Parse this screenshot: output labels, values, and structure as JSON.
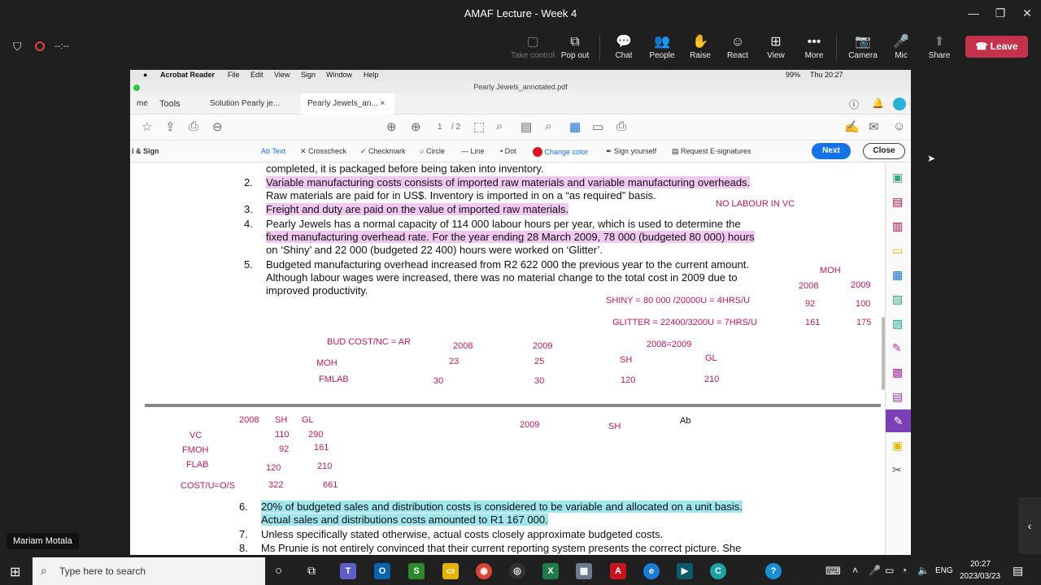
{
  "window": {
    "title": "AMAF Lecture - Week 4",
    "minimize": "—",
    "maximize": "❐",
    "close": "✕"
  },
  "meeting": {
    "timer": "--:--",
    "toolbar": [
      {
        "label": "Take control",
        "icon": "take-control-icon",
        "glyph": "▢"
      },
      {
        "label": "Pop out",
        "icon": "pop-out-icon",
        "glyph": "⧉"
      },
      {
        "label": "Chat",
        "icon": "chat-icon",
        "glyph": "💬"
      },
      {
        "label": "People",
        "icon": "people-icon",
        "glyph": "👥"
      },
      {
        "label": "Raise",
        "icon": "raise-hand-icon",
        "glyph": "✋"
      },
      {
        "label": "React",
        "icon": "react-icon",
        "glyph": "☺"
      },
      {
        "label": "View",
        "icon": "view-icon",
        "glyph": "⊞"
      },
      {
        "label": "More",
        "icon": "more-icon",
        "glyph": "•••"
      },
      {
        "label": "Camera",
        "icon": "camera-icon",
        "glyph": "📷"
      },
      {
        "label": "Mic",
        "icon": "mic-icon",
        "glyph": "🎤"
      },
      {
        "label": "Share",
        "icon": "share-icon",
        "glyph": "⬆"
      }
    ],
    "leave_label": "Leave",
    "presenter_name": "Mariam Motala"
  },
  "acrobat": {
    "mac_menu": [
      "Acrobat Reader",
      "File",
      "Edit",
      "View",
      "Sign",
      "Window",
      "Help"
    ],
    "battery": "99%",
    "clock": "Thu 20:27",
    "doc_title": "Pearly Jewels_annotated.pdf",
    "tabs": [
      "me",
      "Tools",
      "Solution Pearly je...",
      "Pearly Jewels_an..."
    ],
    "page_current": "1",
    "page_total": "/ 2",
    "tool_label": "l & Sign",
    "anno_tools": [
      "Ab Text",
      "Crosscheck",
      "Checkmark",
      "Circle",
      "Line",
      "Dot",
      "Change color",
      "Sign yourself",
      "Request E-signatures"
    ],
    "next_label": "Next",
    "close_label": "Close"
  },
  "document": {
    "lines": [
      {
        "n": "",
        "text": "completed, it is packaged before being taken into inventory."
      },
      {
        "n": "2.",
        "text": "Variable manufacturing costs consists of imported raw materials and variable manufacturing overheads."
      },
      {
        "n": "",
        "text": "Raw materials are paid for in US$.  Inventory is imported in on a “as required” basis."
      },
      {
        "n": "3.",
        "text": "Freight and duty are paid on the value of imported raw materials."
      },
      {
        "n": "4.",
        "text": "Pearly Jewels has a normal capacity of 114 000 labour hours per year, which is used to determine the"
      },
      {
        "n": "",
        "text": "fixed manufacturing overhead rate.  For the year ending 28 March 2009, 78 000 (budgeted 80 000) hours"
      },
      {
        "n": "",
        "text": "on ‘Shiny’ and 22 000 (budgeted 22 400) hours were worked on ‘Glitter’."
      },
      {
        "n": "5.",
        "text": "Budgeted manufacturing overhead increased from R2 622 000 the previous year to the current amount."
      },
      {
        "n": "",
        "text": "Although labour wages were increased, there was no material change to the total cost in 2009 due to"
      },
      {
        "n": "",
        "text": "improved productivity."
      },
      {
        "n": "6.",
        "text": "20% of budgeted sales and distribution costs is considered to be variable and allocated on a unit basis."
      },
      {
        "n": "",
        "text": "Actual sales and distributions costs amounted to R1 167 000."
      },
      {
        "n": "7.",
        "text": "Unless specifically stated otherwise, actual costs closely approximate budgeted costs."
      },
      {
        "n": "8.",
        "text": "Ms Prunie is not entirely convinced that their current reporting system presents the correct picture.  She"
      }
    ],
    "annotations": [
      "NO LABOUR IN VC",
      "MOH",
      "2008",
      "2009",
      "SHINY = 80 000 /20000U = 4HRS/U",
      "92",
      "100",
      "GLITTER = 22400/3200U = 7HRS/U",
      "161",
      "175",
      "BUD COST/NC = AR",
      "2008",
      "2009",
      "2008=2009",
      "MOH",
      "23",
      "25",
      "SH",
      "GL",
      "FMLAB",
      "30",
      "30",
      "120",
      "210",
      "2008",
      "SH",
      "GL",
      "VC",
      "110",
      "290",
      "FMOH",
      "92",
      "161",
      "FLAB",
      "120",
      "210",
      "COST/U=O/S",
      "322",
      "661",
      "2009",
      "SH",
      "Ab"
    ]
  },
  "taskbar": {
    "search_placeholder": "Type here to search",
    "lang": "ENG",
    "time": "20:27",
    "date": "2023/03/23"
  }
}
